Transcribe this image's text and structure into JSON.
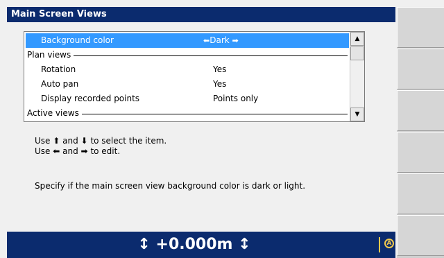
{
  "window": {
    "title": "Main Screen Views"
  },
  "list": {
    "rows": [
      {
        "kind": "item",
        "label": "Background color",
        "value": "Dark",
        "selected": true,
        "left_arrow": "◆",
        "right_arrow": "➡"
      },
      {
        "kind": "section",
        "label": "Plan views"
      },
      {
        "kind": "item",
        "label": "Rotation",
        "value": "Yes"
      },
      {
        "kind": "item",
        "label": "Auto pan",
        "value": "Yes"
      },
      {
        "kind": "item",
        "label": "Display recorded points",
        "value": "Points only"
      },
      {
        "kind": "section",
        "label": "Active views"
      }
    ],
    "scroll_up_icon": "triangle-up-icon",
    "scroll_down_icon": "triangle-down-icon"
  },
  "help": {
    "line1_prefix": "Use",
    "line1_and": "and",
    "line1_suffix": "to select the item.",
    "line2_prefix": "Use",
    "line2_and": "and",
    "line2_suffix": "to edit.",
    "description": "Specify if the main screen view background color is dark or light."
  },
  "status_bar": {
    "height_value": "+0.000m",
    "left_symbol": "↕",
    "right_symbol": "↕",
    "icon": "circle-a-icon",
    "icon_glyph": "A"
  },
  "softkeys": {
    "count": 6
  },
  "colors": {
    "title_bar": "#0b2b6e",
    "selection": "#3399ff",
    "status_bar": "#0b2b6e",
    "status_accent": "#f2c94c"
  }
}
